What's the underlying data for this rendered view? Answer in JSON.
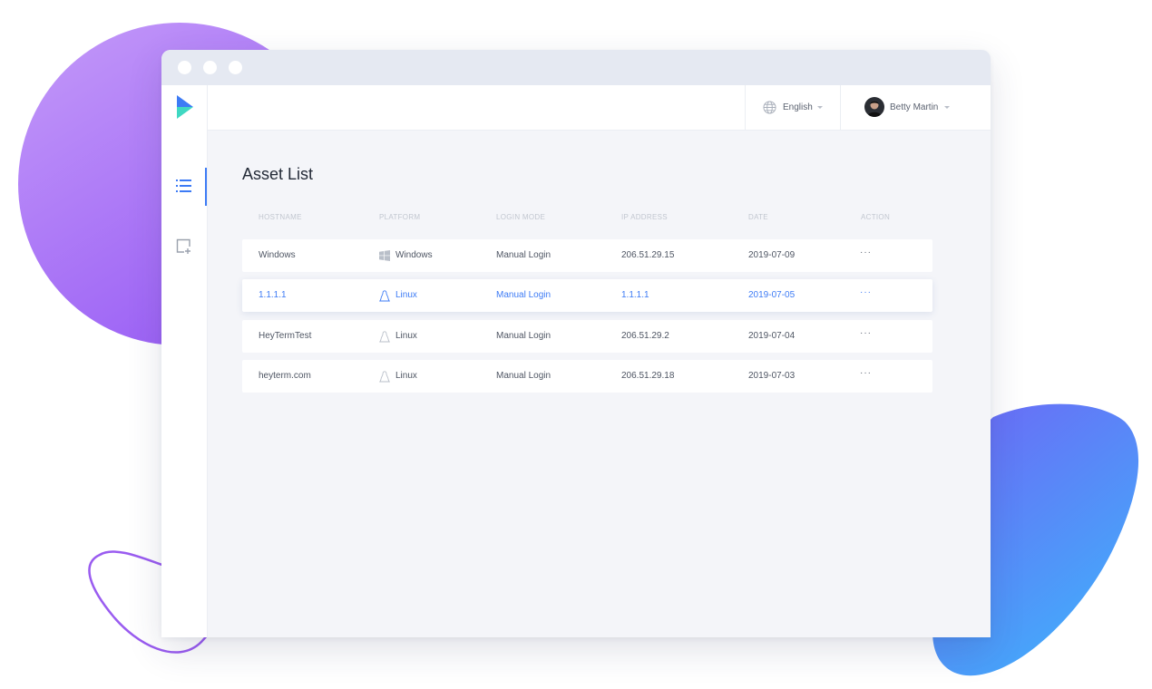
{
  "header": {
    "language": "English",
    "user_name": "Betty Martin"
  },
  "sidebar": {
    "items": [
      {
        "icon": "list-icon",
        "active": true
      },
      {
        "icon": "add-asset-icon",
        "active": false
      }
    ]
  },
  "main": {
    "title": "Asset List",
    "columns": [
      "HOSTNAME",
      "PLATFORM",
      "LOGIN MODE",
      "IP ADDRESS",
      "DATE",
      "ACTION"
    ],
    "rows": [
      {
        "hostname": "Windows",
        "platform": "Windows",
        "platform_icon": "windows-icon",
        "login_mode": "Manual Login",
        "ip": "206.51.29.15",
        "date": "2019-07-09",
        "action": "···",
        "selected": false
      },
      {
        "hostname": "1.1.1.1",
        "platform": "Linux",
        "platform_icon": "linux-icon",
        "login_mode": "Manual Login",
        "ip": "1.1.1.1",
        "date": "2019-07-05",
        "action": "···",
        "selected": true
      },
      {
        "hostname": "HeyTermTest",
        "platform": "Linux",
        "platform_icon": "linux-icon",
        "login_mode": "Manual Login",
        "ip": "206.51.29.2",
        "date": "2019-07-04",
        "action": "···",
        "selected": false
      },
      {
        "hostname": "heyterm.com",
        "platform": "Linux",
        "platform_icon": "linux-icon",
        "login_mode": "Manual Login",
        "ip": "206.51.29.18",
        "date": "2019-07-03",
        "action": "···",
        "selected": false
      }
    ]
  },
  "colors": {
    "accent": "#3d7bf5",
    "logo_top": "#3d7bf5",
    "logo_bottom": "#3fd8c2",
    "blob_purple": "#a46cf7",
    "blob_blue": "#4aa8f8"
  }
}
